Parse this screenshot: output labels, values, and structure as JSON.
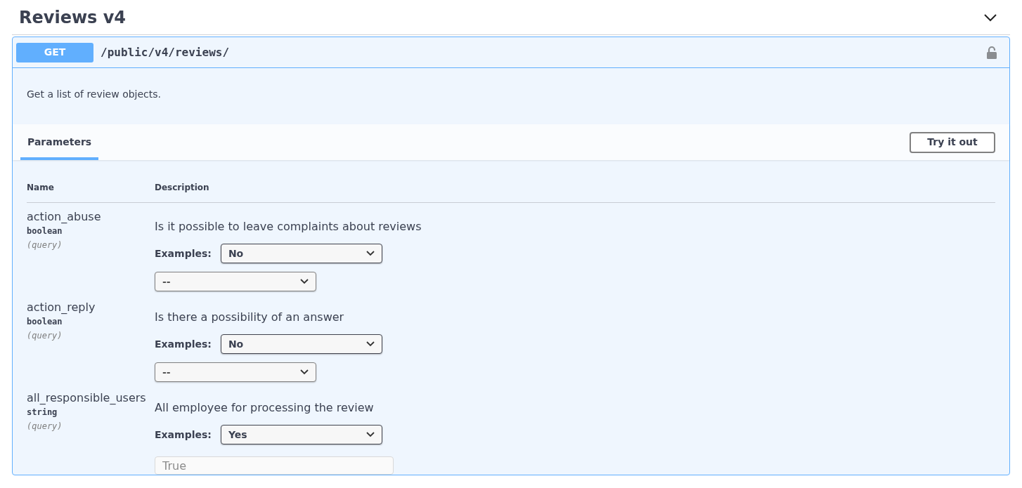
{
  "section": {
    "title": "Reviews v4",
    "expanded": true
  },
  "operation": {
    "method": "GET",
    "path": "/public/v4/reviews/",
    "locked": false,
    "description": "Get a list of review objects."
  },
  "tabs": [
    {
      "label": "Parameters",
      "selected": true
    }
  ],
  "try_button": "Try it out",
  "table": {
    "columns": [
      "Name",
      "Description"
    ],
    "rows": [
      {
        "name": "action_abuse",
        "type": "boolean",
        "location": "(query)",
        "description": "Is it possible to leave complaints about reviews",
        "examples_label": "Examples:",
        "example": "No",
        "input": {
          "kind": "select",
          "value": "--"
        }
      },
      {
        "name": "action_reply",
        "type": "boolean",
        "location": "(query)",
        "description": "Is there a possibility of an answer",
        "examples_label": "Examples:",
        "example": "No",
        "input": {
          "kind": "select",
          "value": "--"
        }
      },
      {
        "name": "all_responsible_users",
        "type": "string",
        "location": "(query)",
        "description": "All employee for processing the review",
        "examples_label": "Examples:",
        "example": "Yes",
        "input": {
          "kind": "text",
          "placeholder": "True"
        }
      }
    ]
  }
}
